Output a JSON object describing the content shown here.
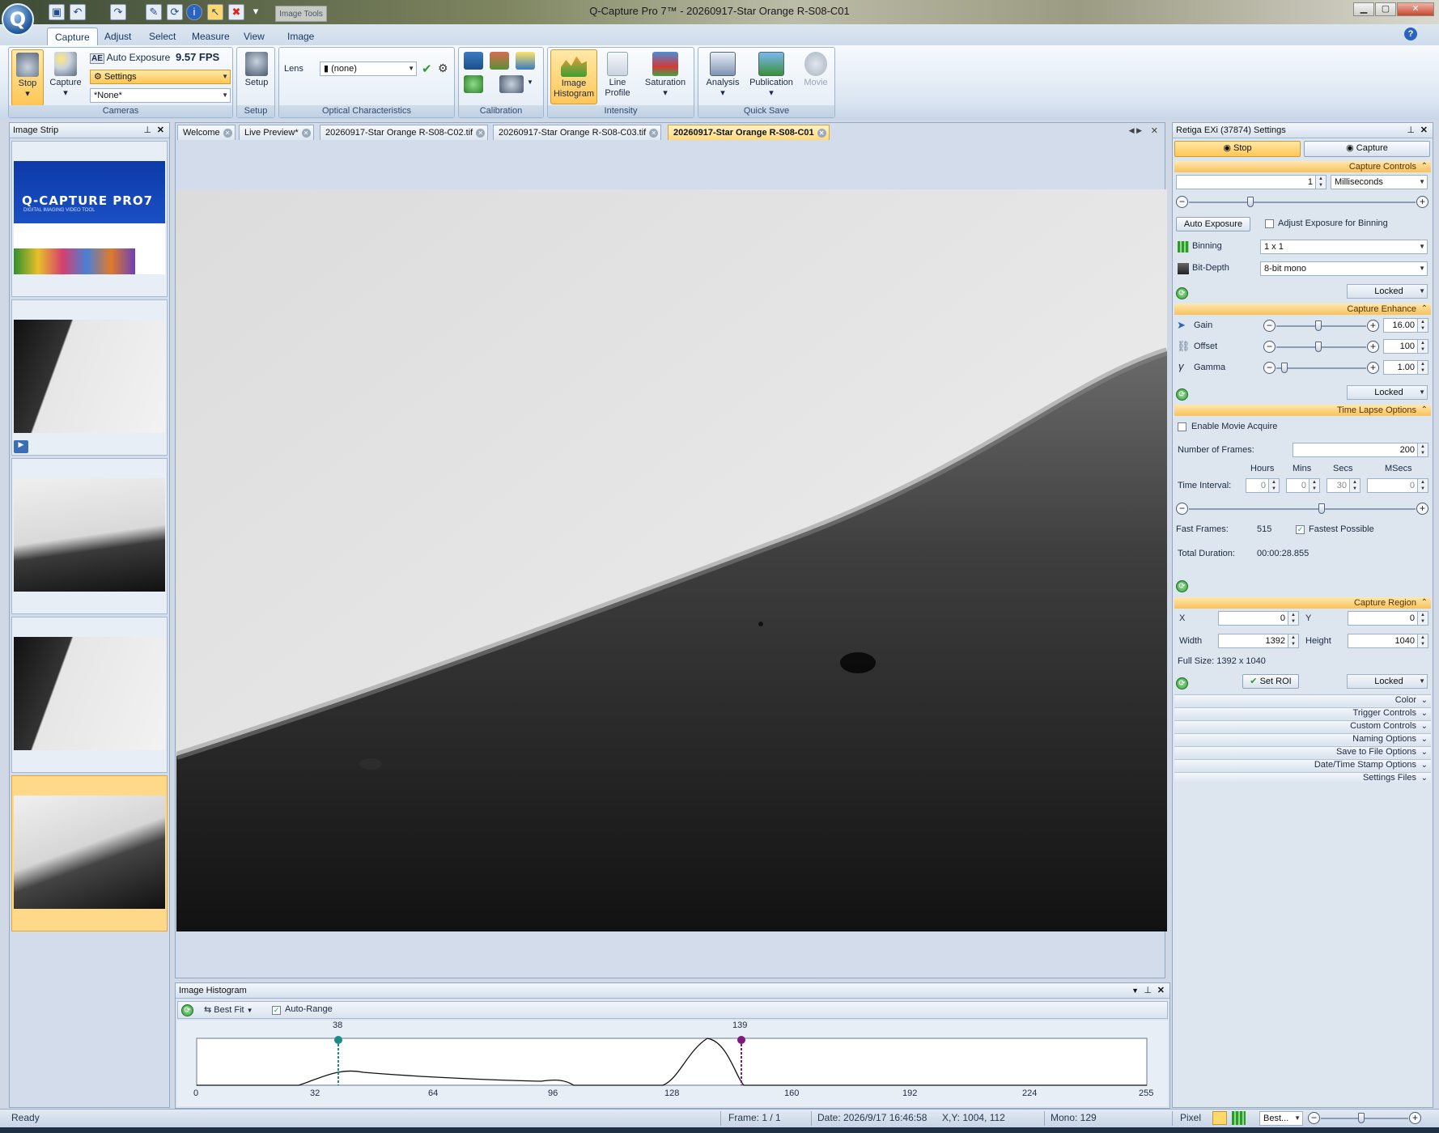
{
  "window": {
    "title": "Q-Capture Pro 7™ - 20260917-Star Orange R-S08-C01",
    "context_tab": "Image Tools"
  },
  "ribbon": {
    "tabs": [
      "Capture",
      "Adjust",
      "Select",
      "Measure",
      "View",
      "Image"
    ],
    "cameras": {
      "stop_label": "Stop",
      "capture_label": "Capture",
      "auto_exposure_label": "Auto Exposure",
      "fps": "9.57 FPS",
      "settings_label": "Settings",
      "preset_value": "*None*",
      "group_label": "Cameras"
    },
    "setup": {
      "button_label": "Setup",
      "group_label": "Setup"
    },
    "optical": {
      "lens_label": "Lens",
      "lens_value": "(none)",
      "group_label": "Optical Characteristics"
    },
    "calibration": {
      "group_label": "Calibration"
    },
    "intensity": {
      "histogram_label": "Image Histogram",
      "line_profile_label": "Line Profile",
      "saturation_label": "Saturation",
      "group_label": "Intensity"
    },
    "quick_save": {
      "analysis_label": "Analysis",
      "publication_label": "Publication",
      "movie_label": "Movie",
      "group_label": "Quick Save"
    }
  },
  "image_strip": {
    "title": "Image Strip",
    "splash_title": "Q-CAPTURE PRO7",
    "splash_subtitle": "DIGITAL IMAGING VIDEO TOOL"
  },
  "documents": {
    "tabs": [
      "Welcome",
      "Live Preview*",
      "20260917-Star Orange R-S08-C02.tif",
      "20260917-Star Orange R-S08-C03.tif",
      "20260917-Star Orange R-S08-C01"
    ],
    "active_index": 4
  },
  "histogram": {
    "title": "Image Histogram",
    "fit_label": "Best Fit",
    "auto_range_label": "Auto-Range",
    "auto_range_checked": true,
    "low_marker": "38",
    "high_marker": "139",
    "x_ticks": [
      "0",
      "32",
      "64",
      "96",
      "128",
      "160",
      "192",
      "224",
      "255"
    ],
    "low_color": "#1a8a8a",
    "high_color": "#7a1a7a"
  },
  "settings": {
    "title": "Retiga EXi (37874) Settings",
    "stop_label": "Stop",
    "capture_label": "Capture",
    "capture_controls": {
      "header": "Capture Controls",
      "exposure_value": "1",
      "exposure_unit": "Milliseconds",
      "auto_exposure_label": "Auto Exposure",
      "adjust_binning_label": "Adjust Exposure for Binning",
      "binning_label": "Binning",
      "binning_value": "1 x 1",
      "bit_depth_label": "Bit-Depth",
      "bit_depth_value": "8-bit mono",
      "locked": "Locked"
    },
    "capture_enhance": {
      "header": "Capture Enhance",
      "gain_label": "Gain",
      "gain_value": "16.00",
      "offset_label": "Offset",
      "offset_value": "100",
      "gamma_label": "Gamma",
      "gamma_value": "1.00",
      "locked": "Locked"
    },
    "time_lapse": {
      "header": "Time Lapse Options",
      "enable_movie_label": "Enable Movie Acquire",
      "frames_label": "Number of Frames:",
      "frames_value": "200",
      "hours_label": "Hours",
      "mins_label": "Mins",
      "secs_label": "Secs",
      "msecs_label": "MSecs",
      "interval_label": "Time Interval:",
      "hours_value": "0",
      "mins_value": "0",
      "secs_value": "30",
      "msecs_value": "0",
      "fast_frames_label": "Fast Frames:",
      "fast_frames_value": "515",
      "fastest_label": "Fastest Possible",
      "total_duration_label": "Total Duration:",
      "total_duration_value": "00:00:28.855"
    },
    "capture_region": {
      "header": "Capture Region",
      "x_label": "X",
      "x_value": "0",
      "y_label": "Y",
      "y_value": "0",
      "width_label": "Width",
      "width_value": "1392",
      "height_label": "Height",
      "height_value": "1040",
      "full_size": "Full Size: 1392 x 1040",
      "set_roi_label": "Set ROI",
      "locked": "Locked"
    },
    "collapsed_sections": [
      "Color",
      "Trigger Controls",
      "Custom Controls",
      "Naming Options",
      "Save to File Options",
      "Date/Time Stamp Options",
      "Settings Files"
    ]
  },
  "status": {
    "ready": "Ready",
    "frame": "Frame: 1 / 1",
    "date": "Date: 2026/9/17 16:46:58",
    "coords": "X,Y: 1004,  112",
    "mono": "Mono:  129",
    "pixel": "Pixel",
    "zoom_mode": "Best..."
  }
}
